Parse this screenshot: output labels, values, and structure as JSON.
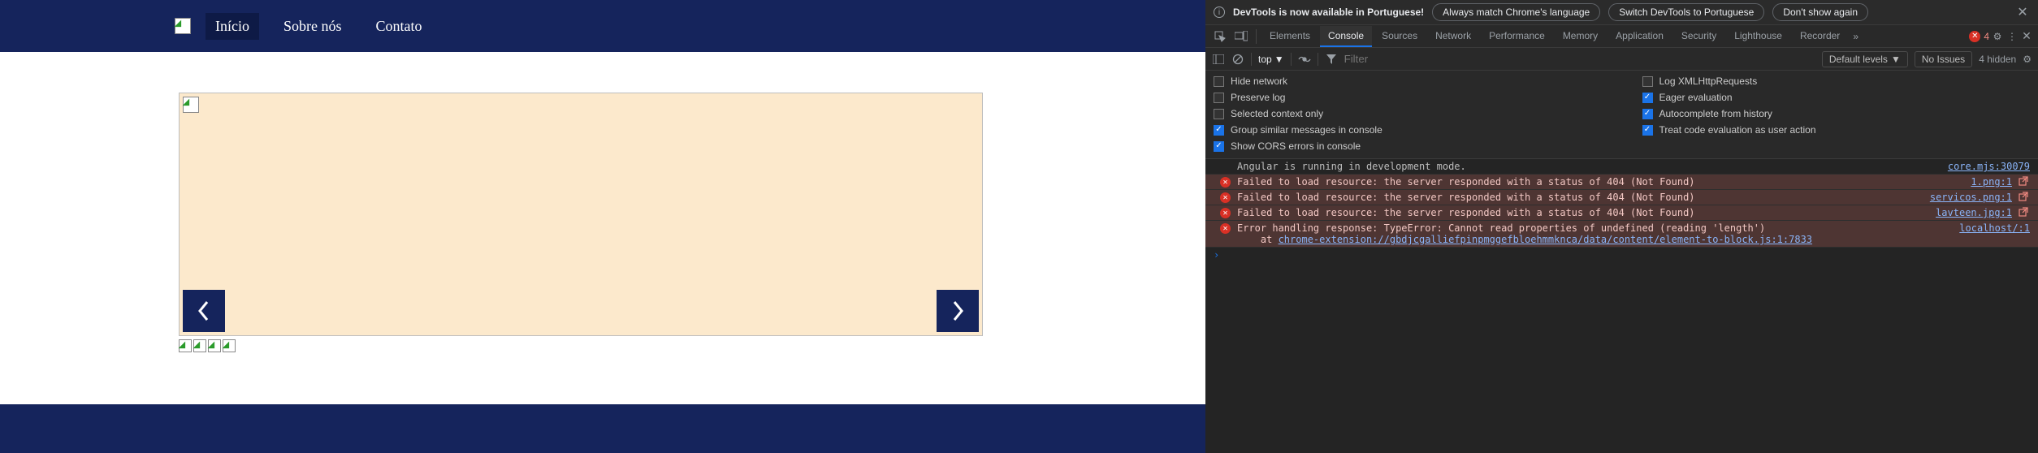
{
  "site": {
    "nav": [
      {
        "label": "Início",
        "active": true
      },
      {
        "label": "Sobre nós",
        "active": false
      },
      {
        "label": "Contato",
        "active": false
      }
    ]
  },
  "devtools": {
    "infobar": {
      "message": "DevTools is now available in Portuguese!",
      "pill1": "Always match Chrome's language",
      "pill2": "Switch DevTools to Portuguese",
      "pill3": "Don't show again"
    },
    "tabs": {
      "elements": "Elements",
      "console": "Console",
      "sources": "Sources",
      "network": "Network",
      "performance": "Performance",
      "memory": "Memory",
      "application": "Application",
      "security": "Security",
      "lighthouse": "Lighthouse",
      "recorder": "Recorder",
      "error_count": "4"
    },
    "consolebar": {
      "context": "top",
      "filter_placeholder": "Filter",
      "levels": "Default levels",
      "no_issues": "No Issues",
      "hidden": "4 hidden"
    },
    "settings": {
      "hide_network": {
        "label": "Hide network",
        "checked": false
      },
      "log_xhr": {
        "label": "Log XMLHttpRequests",
        "checked": false
      },
      "preserve_log": {
        "label": "Preserve log",
        "checked": false
      },
      "eager_eval": {
        "label": "Eager evaluation",
        "checked": true
      },
      "selected_ctx": {
        "label": "Selected context only",
        "checked": false
      },
      "autocomplete": {
        "label": "Autocomplete from history",
        "checked": true
      },
      "group_similar": {
        "label": "Group similar messages in console",
        "checked": true
      },
      "treat_code_eval": {
        "label": "Treat code evaluation as user action",
        "checked": true
      },
      "show_cors": {
        "label": "Show CORS errors in console",
        "checked": true
      }
    },
    "log": {
      "dev_mode": {
        "msg": "Angular is running in development mode.",
        "src": "core.mjs:30079"
      },
      "e404_1": {
        "msg": "Failed to load resource: the server responded with a status of 404 (Not Found)",
        "src": "1.png:1"
      },
      "e404_2": {
        "msg": "Failed to load resource: the server responded with a status of 404 (Not Found)",
        "src": "servicos.png:1"
      },
      "e404_3": {
        "msg": "Failed to load resource: the server responded with a status of 404 (Not Found)",
        "src": "lavteen.jpg:1"
      },
      "err_handle": {
        "msg": "Error handling response: TypeError: Cannot read properties of undefined (reading 'length')",
        "src": "localhost/:1"
      },
      "err_handle_at": "    at ",
      "err_handle_link": "chrome-extension://gbdjcgalliefpinpmggefbloehmmknca/data/content/element-to-block.js:1:7833"
    }
  }
}
